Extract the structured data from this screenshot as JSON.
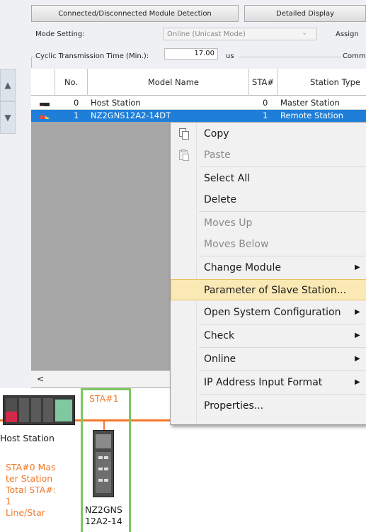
{
  "toolbar": {
    "detection_button": "Connected/Disconnected Module Detection",
    "detailed_button": "Detailed Display"
  },
  "settings": {
    "mode_label": "Mode Setting:",
    "mode_value": "Online (Unicast Mode)",
    "assign_label": "Assign",
    "cyclic_label": "Cyclic Transmission Time (Min.):",
    "cyclic_value": "17.00",
    "cyclic_unit": "us",
    "comm_label": "Commu"
  },
  "grid": {
    "columns": [
      "No.",
      "Model Name",
      "STA#",
      "Station Type"
    ],
    "rows": [
      {
        "no": "0",
        "model": "Host Station",
        "sta": "0",
        "type": "Master Station"
      },
      {
        "no": "1",
        "model": "NZ2GNS12A2-14DT",
        "sta": "1",
        "type": "Remote Station"
      }
    ],
    "scroll_left": "<"
  },
  "context_menu": {
    "items": [
      {
        "label": "Copy",
        "enabled": true
      },
      {
        "label": "Paste",
        "enabled": false
      },
      {
        "label": "Select All",
        "enabled": true
      },
      {
        "label": "Delete",
        "enabled": true
      },
      {
        "label": "Moves Up",
        "enabled": false
      },
      {
        "label": "Moves Below",
        "enabled": false
      },
      {
        "label": "Change Module",
        "enabled": true,
        "submenu": true
      },
      {
        "label": "Parameter of Slave Station...",
        "enabled": true,
        "highlighted": true
      },
      {
        "label": "Open System Configuration",
        "enabled": true,
        "submenu": true
      },
      {
        "label": "Check",
        "enabled": true,
        "submenu": true
      },
      {
        "label": "Online",
        "enabled": true,
        "submenu": true
      },
      {
        "label": "IP Address Input Format",
        "enabled": true,
        "submenu": true
      },
      {
        "label": "Properties...",
        "enabled": true
      }
    ]
  },
  "diagram": {
    "host_label": "Host Station",
    "sta1_label": "STA#1",
    "master_info": [
      "STA#0  Mas",
      "ter Station",
      "Total STA#:",
      "1",
      "Line/Star"
    ],
    "module_label": [
      "NZ2GNS",
      "12A2-14"
    ]
  },
  "colors": {
    "selection": "#1f7fd8",
    "menu_highlight": "#fbe9b5",
    "network_line": "#f4792b",
    "orange_text": "#f07a28",
    "station_border": "#7bc860"
  }
}
